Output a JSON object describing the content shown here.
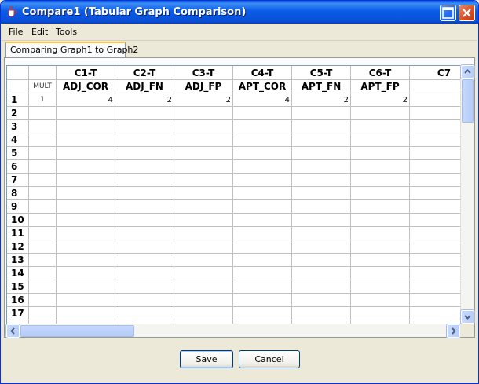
{
  "window": {
    "title": "Compare1 (Tabular Graph Comparison)",
    "accent_color": "#0a5ce8"
  },
  "menu": {
    "items": [
      "File",
      "Edit",
      "Tools"
    ]
  },
  "tab": {
    "label": "Comparing Graph1 to Graph2"
  },
  "table": {
    "column_ids": [
      "C1-T",
      "C2-T",
      "C3-T",
      "C4-T",
      "C5-T",
      "C6-T",
      "C7"
    ],
    "column_names": [
      "ADJ_COR",
      "ADJ_FN",
      "ADJ_FP",
      "APT_COR",
      "APT_FN",
      "APT_FP",
      ""
    ],
    "mult_label": "MULT",
    "row_numbers": [
      "1",
      "2",
      "3",
      "4",
      "5",
      "6",
      "7",
      "8",
      "9",
      "10",
      "11",
      "12",
      "13",
      "14",
      "15",
      "16",
      "17"
    ],
    "rows": [
      {
        "mult": "1",
        "values": [
          "4",
          "2",
          "2",
          "4",
          "2",
          "2",
          ""
        ]
      }
    ]
  },
  "buttons": {
    "save": "Save",
    "cancel": "Cancel"
  },
  "icons": {
    "app": "java-cup-icon",
    "minimize": "minimize-icon",
    "close": "close-icon"
  }
}
